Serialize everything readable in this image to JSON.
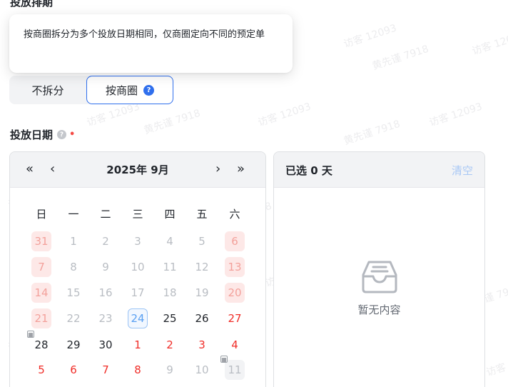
{
  "section": {
    "title": "投放排期"
  },
  "tooltip": {
    "text": "按商圈拆分为多个投放日期相同，仅商圈定向不同的预定单"
  },
  "split": {
    "options": [
      "不拆分",
      "按商圈"
    ],
    "selected": "按商圈",
    "help_icon": "question-circle-icon"
  },
  "date_field": {
    "label": "投放日期",
    "required_mark": "•",
    "help_icon": "question-circle-icon"
  },
  "calendar": {
    "month_title": "2025年 9月",
    "nav": {
      "prev_year": "«",
      "prev_month": "‹",
      "next_month": "›",
      "next_year": "»"
    },
    "weekdays": [
      "日",
      "一",
      "二",
      "三",
      "四",
      "五",
      "六"
    ],
    "weeks": [
      [
        {
          "d": "31",
          "t": "weekend-muted"
        },
        {
          "d": "1",
          "t": "muted"
        },
        {
          "d": "2",
          "t": "muted"
        },
        {
          "d": "3",
          "t": "muted"
        },
        {
          "d": "4",
          "t": "muted"
        },
        {
          "d": "5",
          "t": "muted"
        },
        {
          "d": "6",
          "t": "weekend-muted"
        }
      ],
      [
        {
          "d": "7",
          "t": "weekend-muted"
        },
        {
          "d": "8",
          "t": "muted"
        },
        {
          "d": "9",
          "t": "muted"
        },
        {
          "d": "10",
          "t": "muted"
        },
        {
          "d": "11",
          "t": "muted"
        },
        {
          "d": "12",
          "t": "muted"
        },
        {
          "d": "13",
          "t": "weekend-muted"
        }
      ],
      [
        {
          "d": "14",
          "t": "weekend-muted"
        },
        {
          "d": "15",
          "t": "muted"
        },
        {
          "d": "16",
          "t": "muted"
        },
        {
          "d": "17",
          "t": "muted"
        },
        {
          "d": "18",
          "t": "muted"
        },
        {
          "d": "19",
          "t": "muted"
        },
        {
          "d": "20",
          "t": "weekend-muted"
        }
      ],
      [
        {
          "d": "21",
          "t": "weekend-muted"
        },
        {
          "d": "22",
          "t": "muted"
        },
        {
          "d": "23",
          "t": "muted"
        },
        {
          "d": "24",
          "t": "today"
        },
        {
          "d": "25",
          "t": "normal"
        },
        {
          "d": "26",
          "t": "normal"
        },
        {
          "d": "27",
          "t": "red"
        }
      ],
      [
        {
          "d": "28",
          "t": "normal",
          "tag": true
        },
        {
          "d": "29",
          "t": "normal"
        },
        {
          "d": "30",
          "t": "normal"
        },
        {
          "d": "1",
          "t": "red"
        },
        {
          "d": "2",
          "t": "red"
        },
        {
          "d": "3",
          "t": "red"
        },
        {
          "d": "4",
          "t": "red"
        }
      ],
      [
        {
          "d": "5",
          "t": "red"
        },
        {
          "d": "6",
          "t": "red"
        },
        {
          "d": "7",
          "t": "red"
        },
        {
          "d": "8",
          "t": "red"
        },
        {
          "d": "9",
          "t": "muted"
        },
        {
          "d": "10",
          "t": "muted"
        },
        {
          "d": "11",
          "t": "gray-box",
          "tag": true
        }
      ]
    ]
  },
  "selected_panel": {
    "title": "已选 0 天",
    "clear_label": "清空",
    "empty_text": "暂无内容",
    "empty_icon": "inbox-icon"
  },
  "watermark": {
    "lines": [
      "访客 12093",
      "黄先谨 7918"
    ]
  },
  "colors": {
    "accent": "#2f6fed",
    "weekend": "#f02d28",
    "required": "#f54a45"
  }
}
